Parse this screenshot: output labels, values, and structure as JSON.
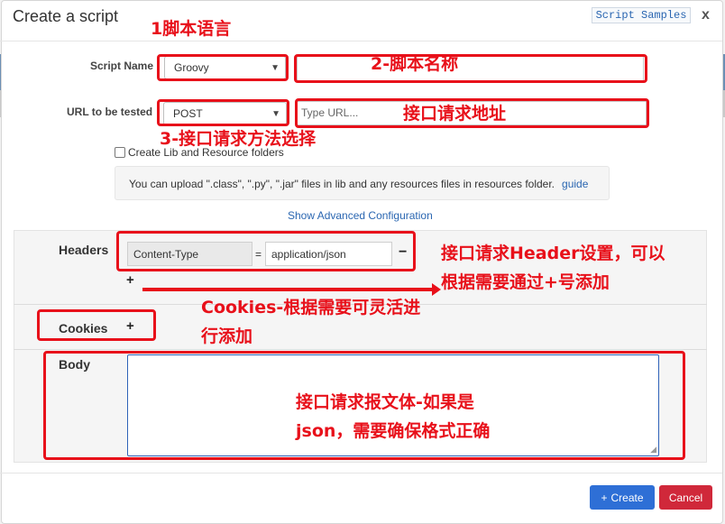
{
  "dialog": {
    "title": "Create a script",
    "samples_label": "Script Samples",
    "close_label": "x"
  },
  "form": {
    "script_name_label": "Script Name",
    "script_type_value": "Groovy",
    "script_name_value": "",
    "url_label": "URL to be tested",
    "method_value": "POST",
    "url_placeholder": "Type URL...",
    "create_lib_label": "Create Lib and Resource folders",
    "info_text": "You can upload \".class\", \".py\", \".jar\" files in lib and any resources files in resources folder.",
    "guide_label": "guide",
    "advanced_label": "Show Advanced Configuration"
  },
  "advanced": {
    "headers_label": "Headers",
    "header_key": "Content-Type",
    "equals": "=",
    "header_value": "application/json",
    "remove_symbol": "−",
    "add_symbol": "+",
    "cookies_label": "Cookies",
    "body_label": "Body"
  },
  "footer": {
    "create_label": "Create",
    "create_icon": "+",
    "cancel_label": "Cancel"
  },
  "annotations": {
    "a1": "1脚本语言",
    "a2": "2-脚本名称",
    "a3": "接口请求地址",
    "a4": "3-接口请求方法选择",
    "a5_line1": "接口请求Header设置，可以",
    "a5_line2": "根据需要通过+号添加",
    "a6_line1": "Cookies-根据需要可灵活进",
    "a6_line2": "行添加",
    "a7_line1": "接口请求报文体-如果是",
    "a7_line2": "json，需要确保格式正确"
  },
  "colors": {
    "annotation": "#e8101a",
    "primary": "#2e6fd6",
    "danger": "#d0283a",
    "link": "#2a66b1"
  }
}
